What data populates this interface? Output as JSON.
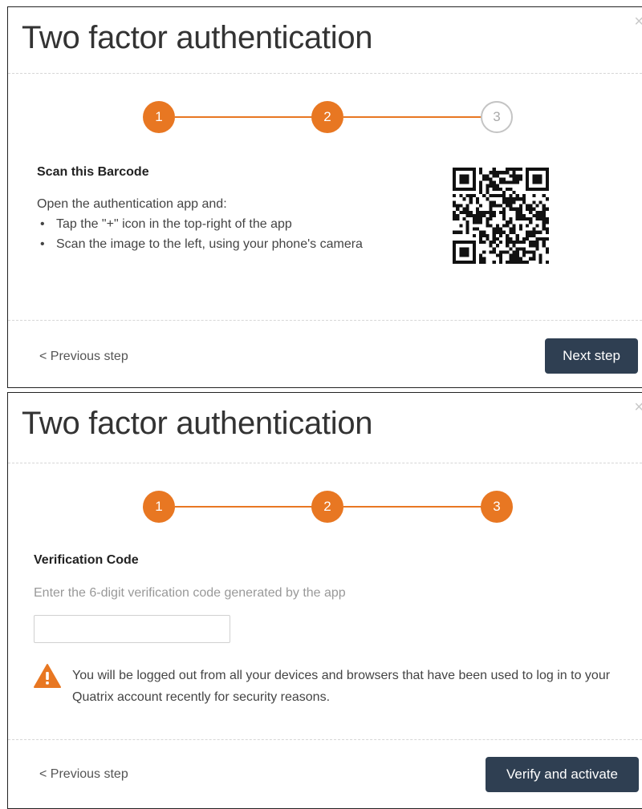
{
  "dialog1": {
    "title": "Two factor authentication",
    "close": "×",
    "steps": [
      "1",
      "2",
      "3"
    ],
    "current_step": 2,
    "heading": "Scan this Barcode",
    "intro": "Open the authentication app and:",
    "instructions": [
      "Tap the \"+\" icon in the top-right of the app",
      "Scan the image to the left, using your phone's camera"
    ],
    "qr_icon": "qr-code",
    "prev_label": "< Previous step",
    "next_label": "Next step"
  },
  "dialog2": {
    "title": "Two factor authentication",
    "close": "×",
    "steps": [
      "1",
      "2",
      "3"
    ],
    "current_step": 3,
    "heading": "Verification Code",
    "description": "Enter the 6-digit verification code generated by the app",
    "code_value": "",
    "code_placeholder": "",
    "warning_icon": "warning-triangle",
    "warning_text": "You will be logged out from all your devices and browsers that have been used to log in to your Quatrix account recently for security reasons.",
    "prev_label": "< Previous step",
    "verify_label": "Verify and activate"
  },
  "colors": {
    "accent": "#e87722",
    "button": "#2f3f52",
    "inactive_step": "#c4c4c4"
  }
}
